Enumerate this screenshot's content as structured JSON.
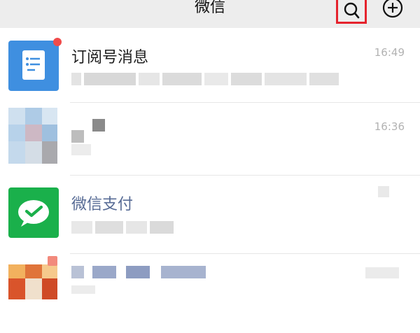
{
  "header": {
    "title": "微信",
    "search_icon": "search-icon",
    "add_icon": "plus-circle-icon",
    "highlight_color": "#e5232d"
  },
  "chats": [
    {
      "name": "订阅号消息",
      "time": "16:49",
      "avatar_icon": "subscription-document-icon",
      "avatar_color": "#3f8fe0",
      "unread_dot": true
    },
    {
      "name": "",
      "time": "16:36",
      "avatar_icon": "blurred-photo",
      "unread_dot": false
    },
    {
      "name": "微信支付",
      "time": "",
      "avatar_icon": "wechat-pay-check-icon",
      "avatar_color": "#1ab04b",
      "unread_dot": false
    },
    {
      "name": "",
      "time": "",
      "avatar_icon": "blurred-photo",
      "unread_dot": true
    }
  ],
  "colors": {
    "topbar_bg": "#ededed",
    "pay_name": "#576b95",
    "time_text": "#b2b2b2",
    "unread_dot": "#f04b4b"
  }
}
